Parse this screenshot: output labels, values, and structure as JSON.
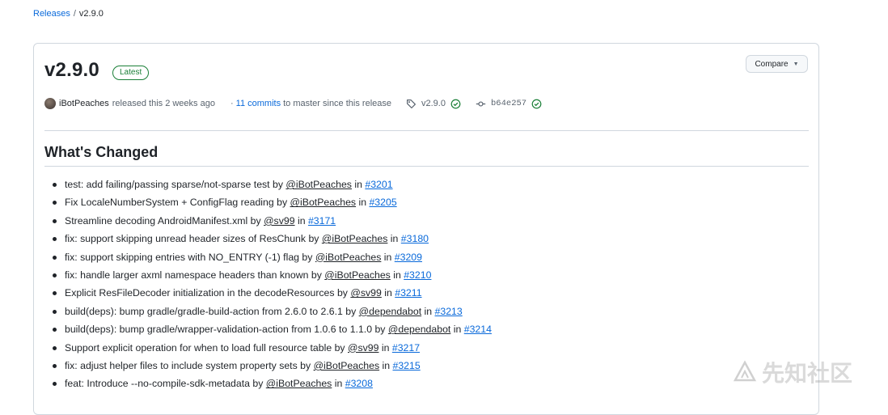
{
  "breadcrumb": {
    "parent": "Releases",
    "separator": "/",
    "current": "v2.9.0"
  },
  "release": {
    "tag_title": "v2.9.0",
    "badge": "Latest",
    "compare_label": "Compare",
    "author": "iBotPeaches",
    "released_text": "released this 2 weeks ago",
    "commits_link": "11 commits",
    "commits_suffix": "to master since this release",
    "tag": "v2.9.0",
    "commit_sha": "b64e257"
  },
  "section_title": "What's Changed",
  "changes": [
    {
      "text": "test: add failing/passing sparse/not-sparse test by ",
      "user": "@iBotPeaches",
      "mid": " in ",
      "pr": "#3201"
    },
    {
      "text": "Fix LocaleNumberSystem + ConfigFlag reading by ",
      "user": "@iBotPeaches",
      "mid": " in ",
      "pr": "#3205"
    },
    {
      "text": "Streamline decoding AndroidManifest.xml by ",
      "user": "@sv99",
      "mid": " in ",
      "pr": "#3171"
    },
    {
      "text": "fix: support skipping unread header sizes of ResChunk by ",
      "user": "@iBotPeaches",
      "mid": " in ",
      "pr": "#3180"
    },
    {
      "text": "fix: support skipping entries with NO_ENTRY (-1) flag by ",
      "user": "@iBotPeaches",
      "mid": " in ",
      "pr": "#3209"
    },
    {
      "text": "fix: handle larger axml namespace headers than known by ",
      "user": "@iBotPeaches",
      "mid": " in ",
      "pr": "#3210"
    },
    {
      "text": "Explicit ResFileDecoder initialization in the decodeResources by ",
      "user": "@sv99",
      "mid": " in ",
      "pr": "#3211"
    },
    {
      "text": "build(deps): bump gradle/gradle-build-action from 2.6.0 to 2.6.1 by ",
      "user": "@dependabot",
      "mid": " in ",
      "pr": "#3213"
    },
    {
      "text": "build(deps): bump gradle/wrapper-validation-action from 1.0.6 to 1.1.0 by ",
      "user": "@dependabot",
      "mid": " in ",
      "pr": "#3214"
    },
    {
      "text": "Support explicit operation for when to load full resource table by ",
      "user": "@sv99",
      "mid": " in ",
      "pr": "#3217"
    },
    {
      "text": "fix: adjust helper files to include system property sets by ",
      "user": "@iBotPeaches",
      "mid": " in ",
      "pr": "#3215"
    },
    {
      "text": "feat: Introduce --no-compile-sdk-metadata by ",
      "user": "@iBotPeaches",
      "mid": " in ",
      "pr": "#3208"
    }
  ],
  "watermark": "先知社区",
  "icons": {
    "tag": "tag-icon",
    "commit": "git-commit-icon",
    "verified": "check-circle-icon",
    "caret": "triangle-down-icon"
  },
  "colors": {
    "link": "#0969da",
    "success": "#1a7f37",
    "border": "#d0d7de",
    "text": "#1f2328",
    "muted": "#59636e"
  }
}
